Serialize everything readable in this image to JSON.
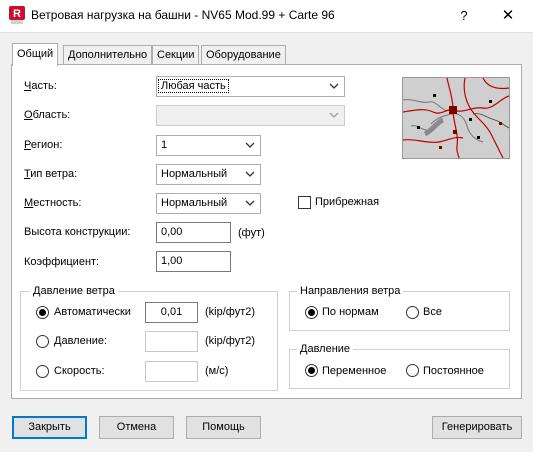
{
  "window": {
    "title": "Ветровая нагрузка на башни - NV65 Mod.99 + Carte 96",
    "app_icon_letter": "R",
    "help_glyph": "?",
    "close_glyph": "✕"
  },
  "tabs": [
    {
      "label": "Общий",
      "active": true
    },
    {
      "label": "Дополнительно",
      "active": false
    },
    {
      "label": "Секции",
      "active": false
    },
    {
      "label": "Оборудование",
      "active": false
    }
  ],
  "fields": {
    "part": {
      "label": "Часть:",
      "value": "Любая часть"
    },
    "area": {
      "label": "Область:",
      "value": ""
    },
    "region": {
      "label": "Регион:",
      "value": "1"
    },
    "wind_type": {
      "label": "Тип ветра:",
      "value": "Нормальный"
    },
    "terrain": {
      "label": "Местность:",
      "value": "Нормальный"
    },
    "coastal": {
      "label": "Прибрежная",
      "checked": false
    },
    "height": {
      "label": "Высота конструкции:",
      "value": "0,00",
      "unit": "(фут)"
    },
    "coefficient": {
      "label": "Коэффициент:",
      "value": "1,00"
    }
  },
  "wind_pressure_group": {
    "title": "Давление ветра",
    "options": [
      {
        "label": "Автоматически",
        "selected": true,
        "value": "0,01",
        "unit": "(kip/фут2)"
      },
      {
        "label": "Давление:",
        "selected": false,
        "value": "",
        "unit": "(kip/фут2)"
      },
      {
        "label": "Скорость:",
        "selected": false,
        "value": "",
        "unit": "(м/с)"
      }
    ]
  },
  "wind_directions_group": {
    "title": "Направления ветра",
    "options": [
      {
        "label": "По нормам",
        "selected": true
      },
      {
        "label": "Все",
        "selected": false
      }
    ]
  },
  "pressure_group": {
    "title": "Давление",
    "options": [
      {
        "label": "Переменное",
        "selected": true
      },
      {
        "label": "Постоянное",
        "selected": false
      }
    ]
  },
  "buttons": {
    "close": "Закрыть",
    "cancel": "Отмена",
    "help": "Помощь",
    "generate": "Генерировать"
  },
  "colors": {
    "accent": "#0078d7",
    "app_icon": "#c8102e",
    "map_lines": "#c00000"
  },
  "icons": {
    "dropdown": "chevron-down-icon",
    "map": "region-map-image"
  }
}
